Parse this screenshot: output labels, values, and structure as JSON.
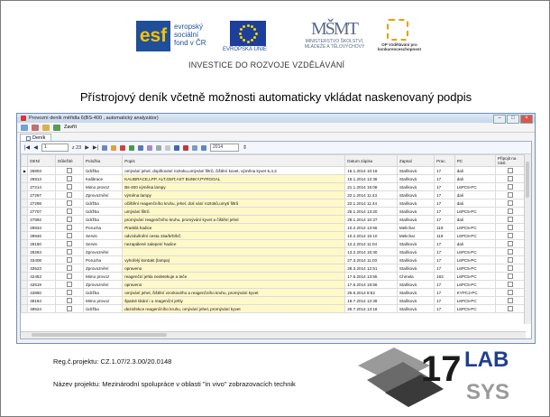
{
  "banner": {
    "esf_mark": "esf",
    "esf_text": [
      "evropský",
      "sociální",
      "fond v ČR"
    ],
    "eu_text": "EVROPSKÁ UNIE",
    "msmt_letters": "MŠMT",
    "msmt_text": "MINISTERSTVO ŠKOLSTVÍ, MLÁDEŽE A TĚLOVÝCHOVY",
    "op_text": "OP Vzdělávání pro konkurenceschopnost",
    "invest": "INVESTICE DO ROZVOJE VZDĚLÁVÁNÍ"
  },
  "slide_title": "Přístrojový deník včetně možnosti automaticky vkládat naskenovaný podpis",
  "window": {
    "title": "Provozní deník měřidla 6(BS-400 , automatický analyzátor)",
    "menu_close": "Zavřít",
    "tab": "Deník",
    "nav_record": "1",
    "nav_total": "z 23",
    "nav_year": "2014",
    "columns": [
      "DEN/",
      "Důležité",
      "Položka",
      "Popis",
      "Datum zápisu",
      "Zapsal",
      "Prac.",
      "PC",
      "Připojit na násl."
    ],
    "rows": [
      {
        "id": "26803",
        "item": "Údržba",
        "desc": "omývání jehel, doplňování roztoku,umývání filtrů, čištění kovet, výměna kyvet 5,4,3",
        "date": "16.1.2014 10:19",
        "by": "Staňková",
        "prac": "17",
        "pc": "dali",
        "sel": true
      },
      {
        "id": "26913",
        "item": "Kalibrace",
        "desc": "KALIBRACE,LPP, ALT,GMT,AST BUNKY,PYROGAL",
        "date": "16.1.2014 12:36",
        "by": "Staňková",
        "prac": "17",
        "pc": "dali"
      },
      {
        "id": "27214",
        "item": "Mimo provoz",
        "desc": "Bs-400 výměna lampy",
        "date": "21.1.2014 15:08",
        "by": "Staňková",
        "prac": "17",
        "pc": "L6PC5-PC"
      },
      {
        "id": "27297",
        "item": "Zprovoznění",
        "desc": "výměna lampy",
        "date": "22.1.2014 11:43",
        "by": "Staňková",
        "prac": "17",
        "pc": "dali"
      },
      {
        "id": "27298",
        "item": "Údržba",
        "desc": "očištění reagenčního kruhu, jehel, doli vání roztoků,umytí filtrů",
        "date": "22.1.2014 11:44",
        "by": "Staňková",
        "prac": "17",
        "pc": "dali"
      },
      {
        "id": "27707",
        "item": "Údržba",
        "desc": "umývání filtrů",
        "date": "25.1.2014 13:20",
        "by": "Staňková",
        "prac": "17",
        "pc": "L6PC5-PC"
      },
      {
        "id": "27892",
        "item": "Údržba",
        "desc": "promývání reagenčního kruhu, promývání kyvet a čištění jehel",
        "date": "28.1.2014 10:37",
        "by": "Staňková",
        "prac": "17",
        "pc": "dali"
      },
      {
        "id": "28934",
        "item": "Porucha",
        "desc": "Prasklá hadice",
        "date": "10.2.2014 13:56",
        "by": "Melichar",
        "prac": "119",
        "pc": "L6PC5-PC"
      },
      {
        "id": "28946",
        "item": "Servis",
        "desc": "odvzdušnění cesta 15a/b/D/kČ",
        "date": "10.2.2014 15:10",
        "by": "Melichar",
        "prac": "119",
        "pc": "L6PC5-PC"
      },
      {
        "id": "29160",
        "item": "Servis",
        "desc": "nezapálené zalepení hadice",
        "date": "12.2.2014 11:04",
        "by": "Staňková",
        "prac": "17",
        "pc": "dali"
      },
      {
        "id": "29284",
        "item": "Zprovoznění",
        "desc": "",
        "date": "13.2.2014 16:30",
        "by": "Staňková",
        "prac": "17",
        "pc": "L6PC5-PC"
      },
      {
        "id": "33408",
        "item": "Porucha",
        "desc": "vyhořelý kontakt (lampa)",
        "date": "27.3.2014 11:03",
        "by": "Staňková",
        "prac": "17",
        "pc": "L6PC5-PC"
      },
      {
        "id": "33523",
        "item": "Zprovoznění",
        "desc": "opraveno",
        "date": "28.3.2014 12:51",
        "by": "Staňková",
        "prac": "17",
        "pc": "L6PC5-PC"
      },
      {
        "id": "42453",
        "item": "Mimo provoz",
        "desc": "reagenční jehla nedetekuje a teče",
        "date": "17.6.2014 13:55",
        "by": "Chmela",
        "prac": "163",
        "pc": "L6PC5-PC"
      },
      {
        "id": "42519",
        "item": "Zprovoznění",
        "desc": "opraveno",
        "date": "17.6.2014 19:56",
        "by": "Staňková",
        "prac": "17",
        "pc": "L6PC5-PC"
      },
      {
        "id": "43850",
        "item": "Údržba",
        "desc": "omývání jehel, čištění vzorkového  a reagenčního kruhu, promývání kyvet",
        "date": "25.6.2014 8:52",
        "by": "Staňková",
        "prac": "17",
        "pc": "KYPC2-PC"
      },
      {
        "id": "48184",
        "item": "Mimo provoz",
        "desc": "špatné tikání i u reagenční jehly",
        "date": "18.7.2014 12:39",
        "by": "Staňková",
        "prac": "17",
        "pc": "L6PC5-PC"
      },
      {
        "id": "49524",
        "item": "Údržba",
        "desc": "dezinfekce reagenčního kruhu, omývání jehel, promývání kyvet",
        "date": "26.7.2014 13:18",
        "by": "Staňková",
        "prac": "17",
        "pc": "L6PC5-PC"
      }
    ]
  },
  "footer": {
    "reg": "Reg.č.projektu: CZ.1.07/2.3.00/20.0148",
    "name": "Název projektu: Mezinárodní spolupráce v oblasti \"in vivo\" zobrazovacích technik"
  },
  "lab_logo": {
    "number": "17",
    "top": "LAB",
    "bottom": "SYS"
  },
  "colors": {
    "esf_blue": "#1f4e9a",
    "desc_highlight": "#fff8c8",
    "lab_blue": "#1f3f8f"
  }
}
